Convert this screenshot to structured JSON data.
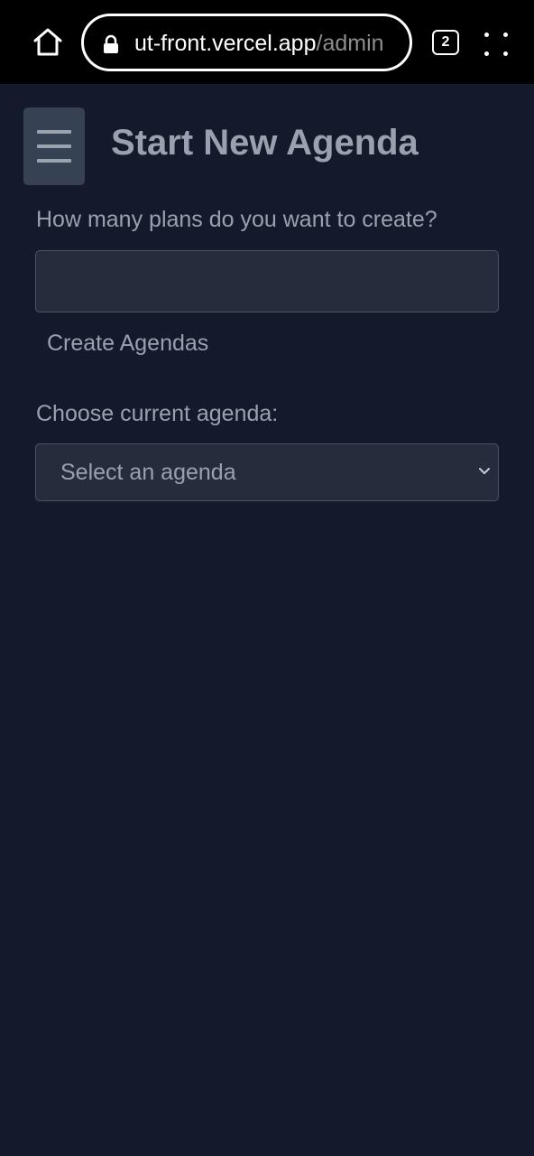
{
  "browser": {
    "url_host": "ut-front.vercel.app",
    "url_path": "/admin",
    "tab_count": "2"
  },
  "header": {
    "title": "Start New Agenda"
  },
  "plans": {
    "label": "How many plans do you want to create?",
    "value": "",
    "placeholder": ""
  },
  "create_button": {
    "label": "Create Agendas"
  },
  "agenda_select": {
    "label": "Choose current agenda:",
    "selected": "Select an agenda"
  },
  "icons": {
    "home": "home-icon",
    "lock": "lock-icon",
    "tabs": "tabs-icon",
    "menu": "more-dots-icon",
    "hamburger": "hamburger-menu-icon",
    "chevron": "chevron-down-icon"
  },
  "colors": {
    "page_background": "#141a2b",
    "input_background": "#252d3d",
    "text_muted": "#9aa1ae",
    "hamburger_background": "#374154"
  }
}
